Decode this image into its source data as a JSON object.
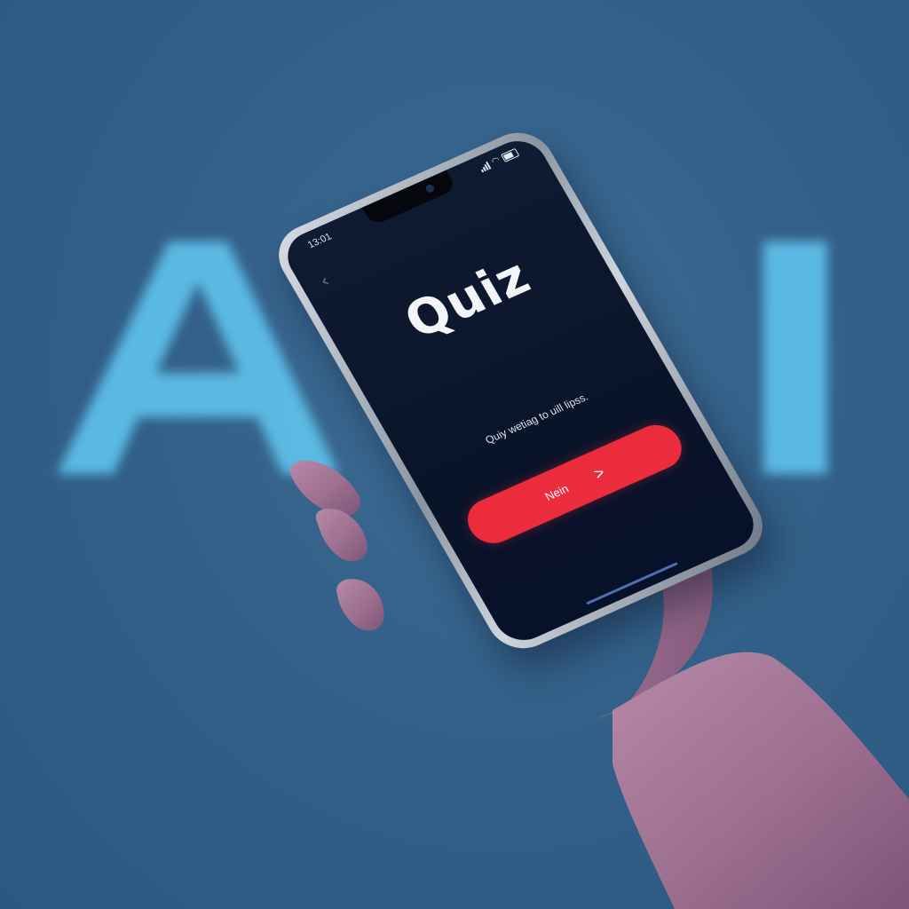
{
  "background": {
    "letters": [
      "A",
      "I"
    ],
    "color": "#3f6d97",
    "letter_color": "#5fc3ec"
  },
  "phone": {
    "status_bar": {
      "time": "13:01",
      "icons": [
        "signal-icon",
        "wifi-icon",
        "battery-icon"
      ]
    },
    "back_icon": "chevron-left-icon",
    "back_glyph": "‹",
    "title": "Quiz",
    "subtitle": "Quiy wetiag to uill lipss.",
    "next_button": {
      "label": "Nein",
      "icon": "chevron-right-icon",
      "glyph": ">",
      "color": "#ea2c3d"
    },
    "screen_color": "#0a1429"
  }
}
